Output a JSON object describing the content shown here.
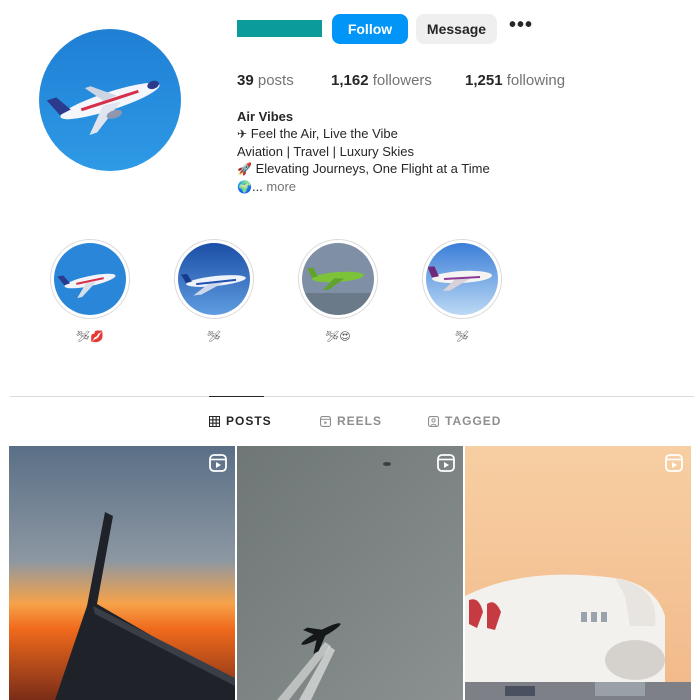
{
  "profile": {
    "follow_label": "Follow",
    "message_label": "Message",
    "more_label": "•••",
    "posts_count": "39",
    "posts_label": "posts",
    "followers_count": "1,162",
    "followers_label": "followers",
    "following_count": "1,251",
    "following_label": "following"
  },
  "bio": {
    "name": "Air Vibes",
    "line1_emoji": "✈",
    "line1": "Feel the Air, Live the Vibe",
    "line2": "Aviation | Travel | Luxury Skies",
    "line3_emoji": "🚀",
    "line3": "Elevating Journeys, One Flight at a Time",
    "line4_emoji": "🌍",
    "line4_prefix": "...",
    "more": "more"
  },
  "highlights": [
    {
      "label": "🛩💋"
    },
    {
      "label": "🛩"
    },
    {
      "label": "🛩😍"
    },
    {
      "label": "🛩"
    }
  ],
  "tabs": [
    {
      "label": "POSTS",
      "icon": "grid-icon",
      "active": true
    },
    {
      "label": "REELS",
      "icon": "reels-icon",
      "active": false
    },
    {
      "label": "TAGGED",
      "icon": "tagged-icon",
      "active": false
    }
  ],
  "posts": [
    {
      "type": "reel",
      "subject": "airplane-wing-sunset"
    },
    {
      "type": "reel",
      "subject": "airplane-contrails"
    },
    {
      "type": "reel",
      "subject": "emirates-a380"
    }
  ],
  "colors": {
    "accent": "#0095f6",
    "username_bar": "#0a9b9a",
    "secondary_button": "#efefef"
  }
}
